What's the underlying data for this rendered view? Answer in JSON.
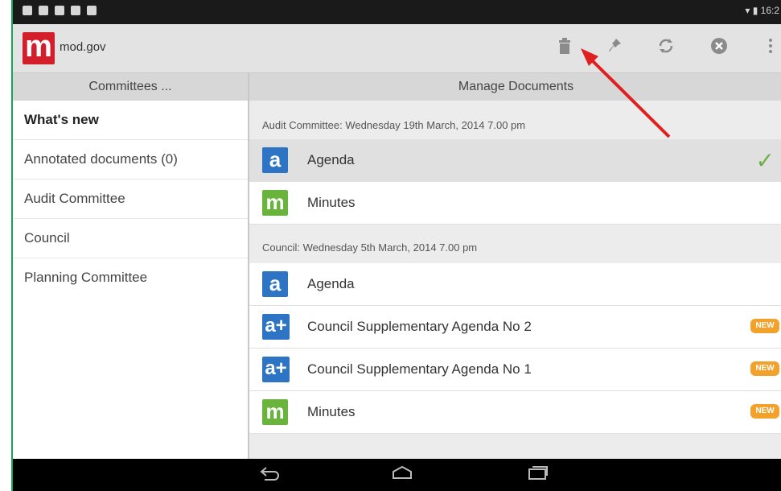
{
  "status_bar": {
    "time": "16:2"
  },
  "app": {
    "logo_letter": "m",
    "title": "mod.gov"
  },
  "toolbar": {
    "icons": [
      "trash-icon",
      "pin-icon",
      "refresh-icon",
      "close-icon",
      "overflow-menu-icon"
    ]
  },
  "headers": {
    "left": "Committees ...",
    "right": "Manage Documents"
  },
  "sidebar": {
    "items": [
      {
        "label": "What's new"
      },
      {
        "label": "Annotated documents (0)"
      },
      {
        "label": "Audit Committee"
      },
      {
        "label": "Council"
      },
      {
        "label": "Planning Committee"
      }
    ]
  },
  "sections": [
    {
      "title": "Audit Committee: Wednesday 19th March, 2014 7.00 pm",
      "docs": [
        {
          "icon": "a",
          "label": "Agenda",
          "selected": true
        },
        {
          "icon": "m",
          "label": "Minutes"
        }
      ]
    },
    {
      "title": "Council: Wednesday 5th March, 2014 7.00 pm",
      "docs": [
        {
          "icon": "a",
          "label": "Agenda"
        },
        {
          "icon": "a+",
          "label": "Council Supplementary Agenda No 2",
          "badge": "NEW"
        },
        {
          "icon": "a+",
          "label": "Council Supplementary Agenda No 1",
          "badge": "NEW"
        },
        {
          "icon": "m",
          "label": "Minutes",
          "badge": "NEW"
        }
      ]
    }
  ],
  "colors": {
    "logo": "#d21f2b",
    "agenda_icon": "#2e74c4",
    "minutes_icon": "#6ab43e",
    "new_badge": "#f2a22b",
    "annotation_arrow": "#e02020"
  }
}
